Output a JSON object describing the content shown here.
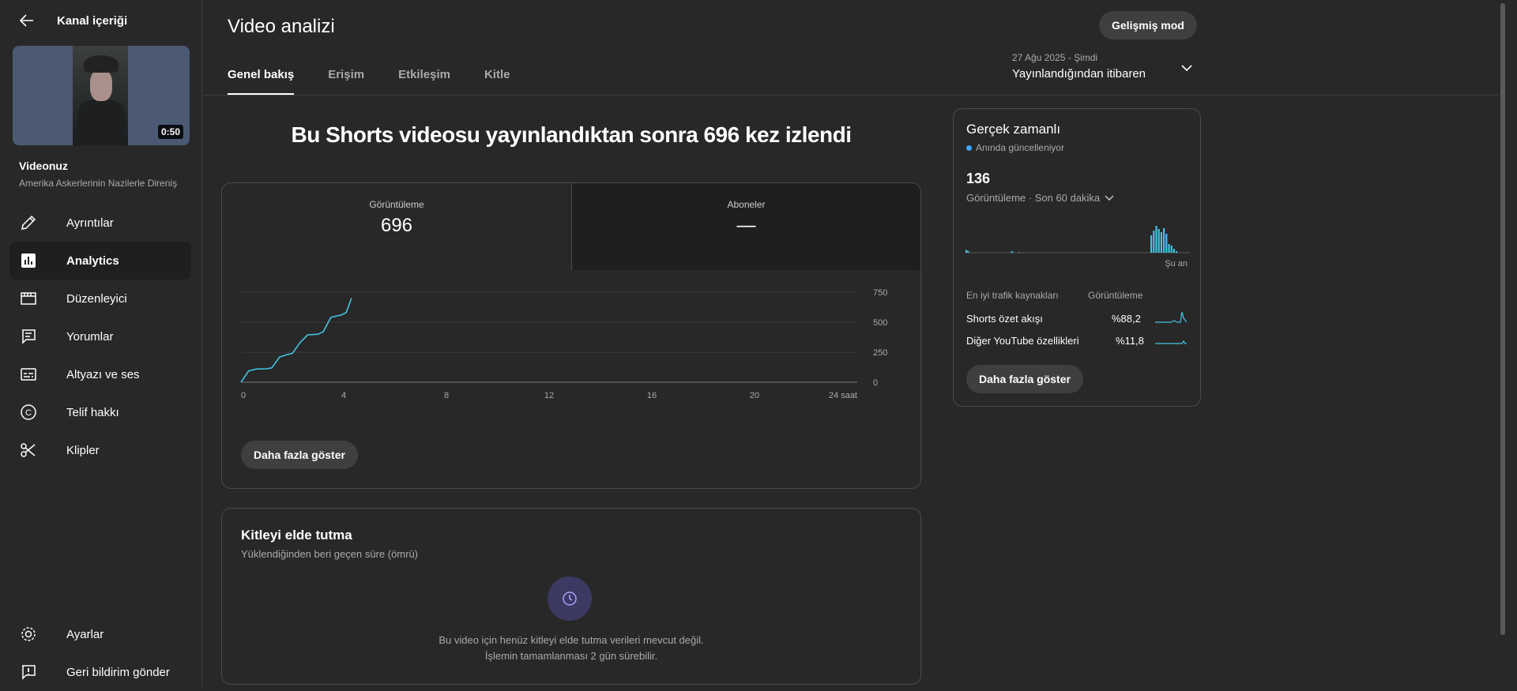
{
  "sidebar": {
    "header_title": "Kanal içeriği",
    "video_duration": "0:50",
    "video_section_title": "Videonuz",
    "video_subtitle": "Amerika Askerlerinin Nazilerle Direniş",
    "nav": [
      {
        "label": "Ayrıntılar",
        "icon": "pencil-icon"
      },
      {
        "label": "Analytics",
        "icon": "analytics-icon",
        "active": true
      },
      {
        "label": "Düzenleyici",
        "icon": "editor-icon"
      },
      {
        "label": "Yorumlar",
        "icon": "comment-icon"
      },
      {
        "label": "Altyazı ve ses",
        "icon": "subtitles-icon"
      },
      {
        "label": "Telif hakkı",
        "icon": "copyright-icon"
      },
      {
        "label": "Klipler",
        "icon": "scissors-icon"
      }
    ],
    "bottom_nav": [
      {
        "label": "Ayarlar",
        "icon": "gear-icon"
      },
      {
        "label": "Geri bildirim gönder",
        "icon": "feedback-icon"
      }
    ]
  },
  "header": {
    "title": "Video analizi",
    "advanced_mode": "Gelişmiş mod",
    "date_range_small": "27 Ağu 2025 - Şimdi",
    "date_range_label": "Yayınlandığından itibaren",
    "tabs": [
      "Genel bakış",
      "Erişim",
      "Etkileşim",
      "Kitle"
    ],
    "active_tab": "Genel bakış"
  },
  "overview": {
    "headline": "Bu Shorts videosu yayınlandıktan sonra 696 kez izlendi",
    "metrics": [
      {
        "label": "Görüntüleme",
        "value": "696"
      },
      {
        "label": "Aboneler",
        "value": "—"
      }
    ],
    "show_more": "Daha fazla göster"
  },
  "chart_data": [
    {
      "type": "line",
      "series": [
        {
          "x": [
            0,
            0.3,
            0.6,
            1.0,
            1.2,
            1.5,
            1.8,
            2.0,
            2.3,
            2.6,
            3.0,
            3.2,
            3.5,
            3.9,
            4.1,
            4.3
          ],
          "y": [
            0,
            95,
            110,
            112,
            120,
            210,
            230,
            240,
            330,
            395,
            400,
            420,
            540,
            560,
            580,
            700
          ]
        }
      ],
      "x_ticks": [
        "0",
        "4",
        "8",
        "12",
        "16",
        "20",
        "24 saat"
      ],
      "x_tick_values": [
        0,
        4,
        8,
        12,
        16,
        20,
        24
      ],
      "y_ticks": [
        "0",
        "250",
        "500",
        "750"
      ],
      "y_tick_values": [
        0,
        250,
        500,
        750
      ],
      "xlim": [
        0,
        24
      ],
      "ylim": [
        0,
        750
      ],
      "grid": true,
      "color": "#41c5e3"
    },
    {
      "type": "bar",
      "values": [
        4,
        3,
        2,
        1,
        0,
        0,
        0,
        0,
        0,
        0,
        0,
        0,
        0,
        0,
        0,
        0,
        0,
        0,
        0,
        0,
        0,
        0,
        0,
        0,
        0,
        0,
        0,
        0,
        0,
        0,
        0,
        2,
        2,
        1,
        0,
        1,
        0,
        0,
        0,
        0,
        0,
        0,
        0,
        0,
        0,
        0,
        0,
        0,
        0,
        0,
        0,
        0,
        0,
        0,
        0,
        0,
        0,
        0,
        0,
        0,
        0,
        0,
        0,
        0,
        0,
        0,
        0,
        0,
        0,
        0,
        0,
        0,
        0,
        0,
        0,
        0,
        0,
        0,
        0,
        0,
        0,
        0,
        0,
        0,
        0,
        0,
        0,
        0,
        0,
        0,
        0,
        0,
        0,
        0,
        0,
        0,
        0,
        0,
        0,
        0,
        0,
        0,
        0,
        0,
        0,
        0,
        0,
        0,
        0,
        0,
        0,
        0,
        0,
        0,
        0,
        0,
        0,
        0,
        0,
        0,
        0,
        0,
        0,
        0,
        0,
        1,
        0,
        0,
        0,
        0,
        0,
        0,
        0,
        0,
        0,
        0,
        0,
        1,
        0,
        0,
        0,
        0,
        0,
        0,
        0,
        0,
        0,
        0,
        0,
        0,
        0,
        0,
        0,
        0,
        0,
        0,
        0,
        0,
        0,
        0,
        0,
        0,
        0,
        0,
        0,
        0,
        0,
        1,
        0,
        0,
        0,
        0,
        0,
        0,
        0,
        0,
        0,
        0,
        0,
        0,
        0,
        0,
        0,
        0,
        0,
        0,
        0,
        0,
        0,
        0,
        0,
        0,
        0,
        0,
        0,
        0,
        0,
        0,
        0,
        0,
        0,
        0,
        0,
        0,
        0,
        0,
        0,
        0,
        0,
        0,
        0,
        0,
        0,
        0,
        0,
        0,
        0,
        0,
        0,
        0,
        0,
        0,
        0,
        0,
        0,
        0,
        0,
        0
      ],
      "color": "#41c5e3"
    }
  ],
  "realtime": {
    "title": "Gerçek zamanlı",
    "subtitle": "Anında güncelleniyor",
    "value": "136",
    "period": "Görüntüleme · Son 60 dakika",
    "now_label": "Şu an",
    "bars": [
      4,
      3,
      2,
      1,
      1,
      0,
      0,
      0,
      0,
      0,
      0,
      0,
      0,
      0,
      0,
      0,
      0,
      0,
      0,
      0,
      0,
      0,
      0,
      0,
      0,
      2,
      2,
      1,
      0,
      1,
      0,
      0,
      0,
      0,
      0,
      0,
      0,
      0,
      0,
      0,
      0,
      0,
      0,
      0,
      0,
      0,
      0,
      0,
      0,
      0,
      0,
      0,
      0,
      0,
      0,
      0,
      0,
      0,
      0,
      0,
      0,
      0,
      0,
      0,
      0,
      0,
      0,
      0,
      0,
      0,
      0,
      0,
      0,
      0,
      0,
      0,
      0,
      0,
      0,
      0,
      0,
      0,
      0,
      0,
      0,
      0,
      0,
      0,
      0,
      0,
      0,
      0,
      0,
      0,
      0,
      0,
      0,
      0,
      0,
      0,
      0,
      0,
      0,
      0,
      0,
      0,
      0,
      0,
      0,
      0,
      0,
      0,
      0,
      0,
      0,
      0,
      0,
      0,
      0,
      0,
      0,
      0,
      0,
      0,
      0,
      0,
      0,
      0,
      0,
      0,
      0,
      0,
      0,
      0,
      0,
      0,
      0,
      0,
      0,
      0,
      0,
      0,
      0,
      0,
      0,
      0,
      0,
      0,
      0,
      0,
      0,
      0,
      0,
      0,
      0,
      0,
      0,
      0,
      0,
      0,
      0,
      0,
      0,
      0,
      0,
      0,
      0,
      0,
      0,
      0,
      0,
      0,
      0,
      0,
      0,
      0,
      0,
      0,
      0,
      0,
      0,
      0,
      0,
      0,
      0,
      0,
      0,
      0,
      0,
      0,
      0,
      0,
      1,
      0,
      0,
      0,
      0,
      0,
      0,
      0,
      0,
      0,
      0,
      0,
      0,
      0,
      0,
      0,
      0,
      0,
      0,
      0,
      0,
      0,
      0,
      0,
      0,
      0,
      0,
      0,
      0,
      0,
      0,
      0,
      0,
      0
    ],
    "peak_bars": [
      22,
      28,
      34,
      30,
      26,
      31,
      24,
      11,
      9,
      5,
      2
    ],
    "traffic_header": "En iyi trafik kaynakları",
    "traffic_col": "Görüntüleme",
    "traffic": [
      {
        "label": "Shorts özet akışı",
        "pct": "%88,2"
      },
      {
        "label": "Diğer YouTube özellikleri",
        "pct": "%11,8"
      }
    ],
    "show_more": "Daha fazla göster"
  },
  "retention": {
    "title": "Kitleyi elde tutma",
    "subtitle": "Yüklendiğinden beri geçen süre (ömrü)",
    "message_line1": "Bu video için henüz kitleyi elde tutma verileri mevcut değil.",
    "message_line2": "İşlemin tamamlanması 2 gün sürebilir."
  }
}
